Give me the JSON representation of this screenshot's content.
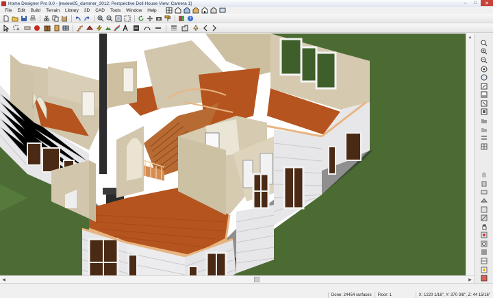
{
  "window": {
    "title": "Home Designer Pro 9.0 - [review05_dummer_3012: Perspective Doll House View: Camera 1]",
    "minimize": "–",
    "maximize": "□",
    "close": "✕"
  },
  "menu": {
    "items": [
      "File",
      "Edit",
      "Build",
      "Terrain",
      "Library",
      "3D",
      "CAD",
      "Tools",
      "Window",
      "Help"
    ]
  },
  "scroll": {
    "up": "▲",
    "down": "▼",
    "left": "◀",
    "right": "▶"
  },
  "status": {
    "surfaces": "Done: 24454 surfaces",
    "floor": "Floor: 1",
    "coords": "X: 1220 1/16\", Y: 370 3/8\", Z: 44 15/16\""
  },
  "colors": {
    "grass": "#4b6b33",
    "floor_wood": "#b5541f",
    "wall_interior": "#d2c7ad",
    "siding": "#e7e7ea",
    "trim": "#e8b581",
    "chimney": "#2d2d30"
  }
}
